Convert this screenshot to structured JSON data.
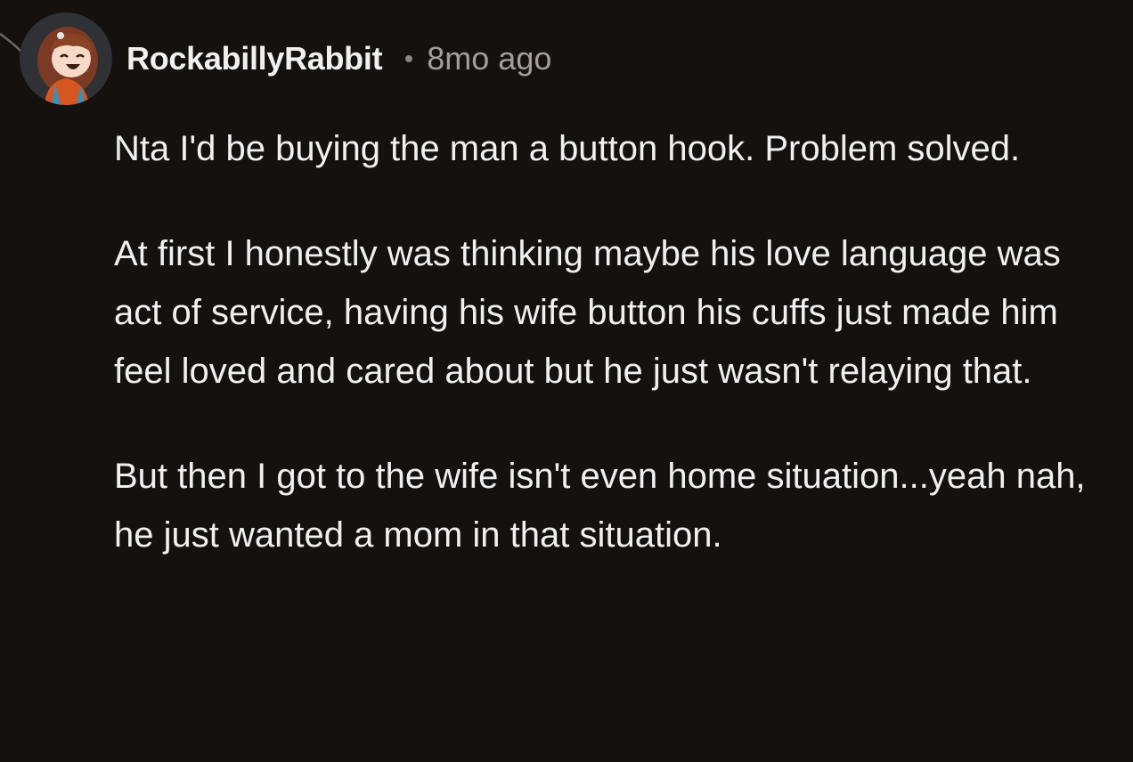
{
  "comment": {
    "author": "RockabillyRabbit",
    "timestamp": "8mo ago",
    "paragraphs": [
      "Nta I'd be buying the man a button hook. Problem solved.",
      "At first I honestly was thinking maybe his love language was act of service, having his wife button his cuffs just made him feel loved and cared about but he just wasn't relaying that.",
      "But then I got to the wife isn't even home situation...yeah nah, he just wanted a mom in that situation."
    ]
  },
  "colors": {
    "background": "#15110f",
    "text": "#f2f0ee",
    "meta": "#a59e98"
  },
  "icons": {
    "avatar": "cartoon-girl-avatar-icon",
    "thread": "thread-branch-icon"
  }
}
